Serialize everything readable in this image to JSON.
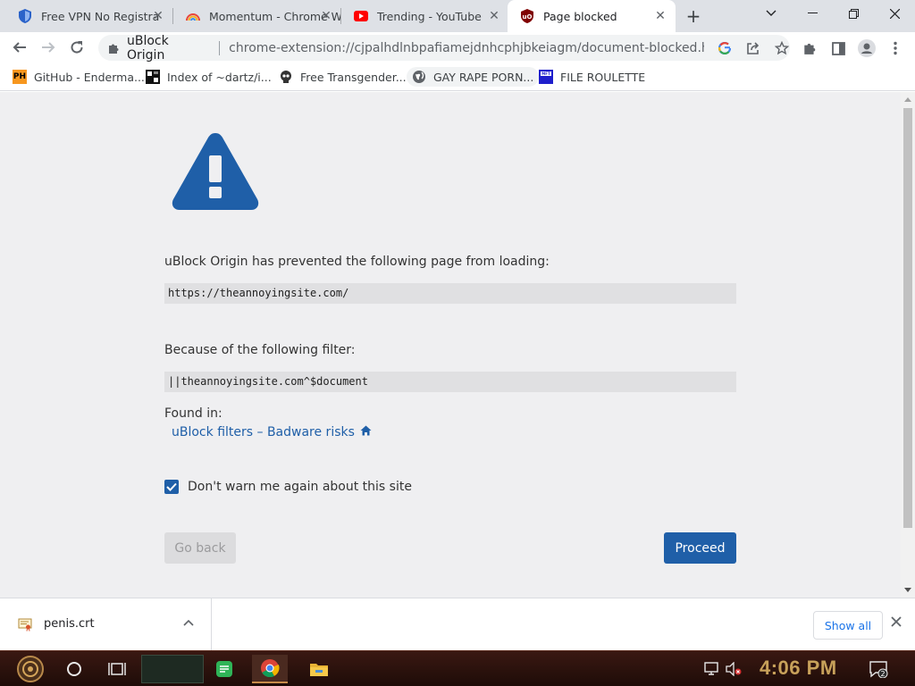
{
  "tabs": [
    {
      "title": "Free VPN No Registra",
      "favicon": "shield-icon",
      "active": false
    },
    {
      "title": "Momentum - Chrome W",
      "favicon": "rainbow-icon",
      "active": false
    },
    {
      "title": "Trending - YouTube",
      "favicon": "youtube-icon",
      "active": false
    },
    {
      "title": "Page blocked",
      "favicon": "ublock-icon",
      "active": true
    }
  ],
  "toolbar": {
    "site_name": "uBlock Origin",
    "url": "chrome-extension://cjpalhdlnbpafiamejdnhcphjbkeiagm/document-blocked.html..."
  },
  "bookmarks": [
    {
      "label": "GitHub - Enderma...",
      "favicon": "PH"
    },
    {
      "label": "Index of ~dartz/i...",
      "favicon": "grid-icon"
    },
    {
      "label": "Free Transgender...",
      "favicon": "skull-icon"
    },
    {
      "label": "GAY RAPE PORN...",
      "favicon": "globe-icon"
    },
    {
      "label": "FILE ROULETTE",
      "favicon": "file-icon"
    }
  ],
  "page": {
    "prevented_text": "uBlock Origin has prevented the following page from loading:",
    "blocked_url": "https://theannoyingsite.com/",
    "because_text": "Because of the following filter:",
    "filter": "||theannoyingsite.com^$document",
    "found_in_label": "Found in:",
    "found_in_list": "uBlock filters – Badware risks",
    "dont_warn_label": "Don't warn me again about this site",
    "dont_warn_checked": true,
    "go_back_label": "Go back",
    "proceed_label": "Proceed"
  },
  "downloads": {
    "file_name": "penis.crt",
    "show_all_label": "Show all"
  },
  "taskbar": {
    "time": "4:06 PM",
    "notification_count": "2"
  },
  "colors": {
    "accent": "#1f5fa8",
    "page_bg": "#efeff1"
  }
}
